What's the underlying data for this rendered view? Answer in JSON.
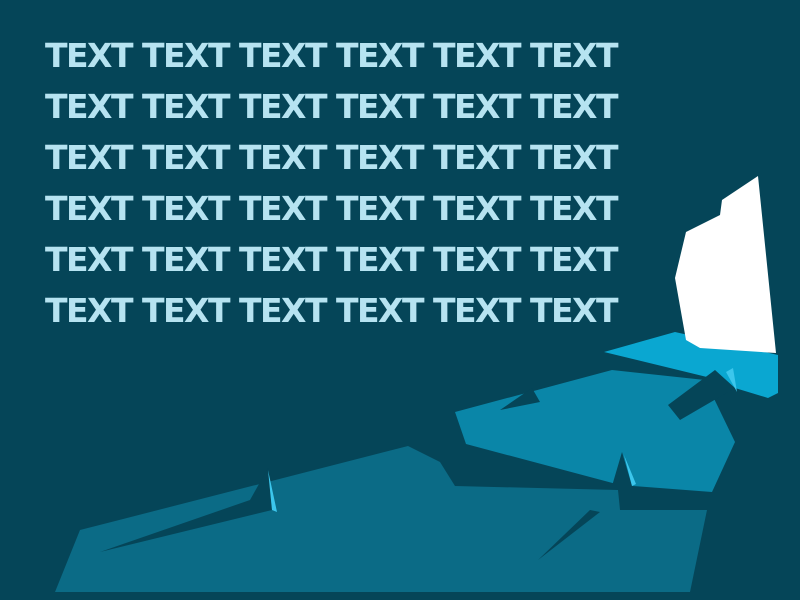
{
  "colors": {
    "background": "#054558",
    "text": "#b6e3f1",
    "floe_dark": "#0b6b86",
    "floe_mid": "#0a86a8",
    "floe_light": "#0aa7d1",
    "iceberg": "#ffffff",
    "crack": "#054558",
    "shard": "#3cc6ec"
  },
  "text_lines": [
    "TEXT TEXT TEXT TEXT TEXT TEXT",
    "TEXT TEXT TEXT TEXT TEXT TEXT",
    "TEXT TEXT TEXT TEXT TEXT TEXT",
    "TEXT TEXT TEXT TEXT TEXT TEXT",
    "TEXT TEXT TEXT TEXT TEXT TEXT",
    "TEXT TEXT TEXT TEXT TEXT TEXT"
  ]
}
